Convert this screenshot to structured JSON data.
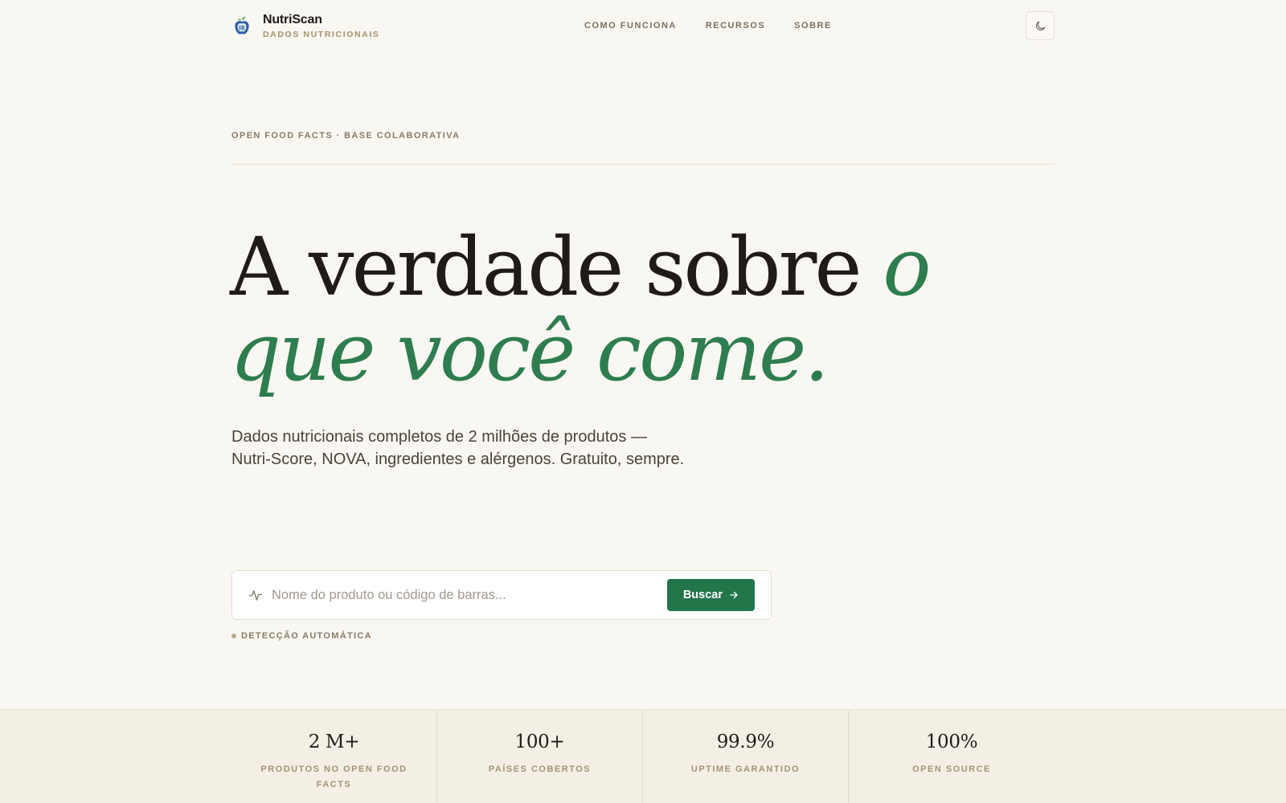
{
  "brand": {
    "name": "NutriScan",
    "subtitle": "DADOS NUTRICIONAIS",
    "logo_icon": "apple-icon"
  },
  "nav": {
    "items": [
      {
        "label": "COMO FUNCIONA"
      },
      {
        "label": "RECURSOS"
      },
      {
        "label": "SOBRE"
      }
    ],
    "theme_toggle_icon": "moon-icon"
  },
  "hero": {
    "eyebrow": "OPEN FOOD FACTS · BASE COLABORATIVA",
    "title_plain": "A verdade sobre",
    "title_accent_1": "o",
    "title_accent_2": "que você come.",
    "description": "Dados nutricionais completos de 2 milhões de produtos — Nutri-Score, NOVA, ingredientes e alérgenos. Gratuito, sempre."
  },
  "search": {
    "icon": "activity-icon",
    "placeholder": "Nome do produto ou código de barras...",
    "value": "",
    "button_label": "Buscar",
    "button_icon": "arrow-right-icon",
    "hint": "DETECÇÃO AUTOMÁTICA"
  },
  "stats": [
    {
      "value": "2 M+",
      "label": "PRODUTOS NO OPEN FOOD FACTS"
    },
    {
      "value": "100+",
      "label": "PAÍSES COBERTOS"
    },
    {
      "value": "99.9%",
      "label": "UPTIME GARANTIDO"
    },
    {
      "value": "100%",
      "label": "OPEN SOURCE"
    }
  ],
  "colors": {
    "background": "#f9f7f2",
    "accent": "#2e7d4f",
    "button": "#23754a",
    "muted": "#8a7c66"
  }
}
